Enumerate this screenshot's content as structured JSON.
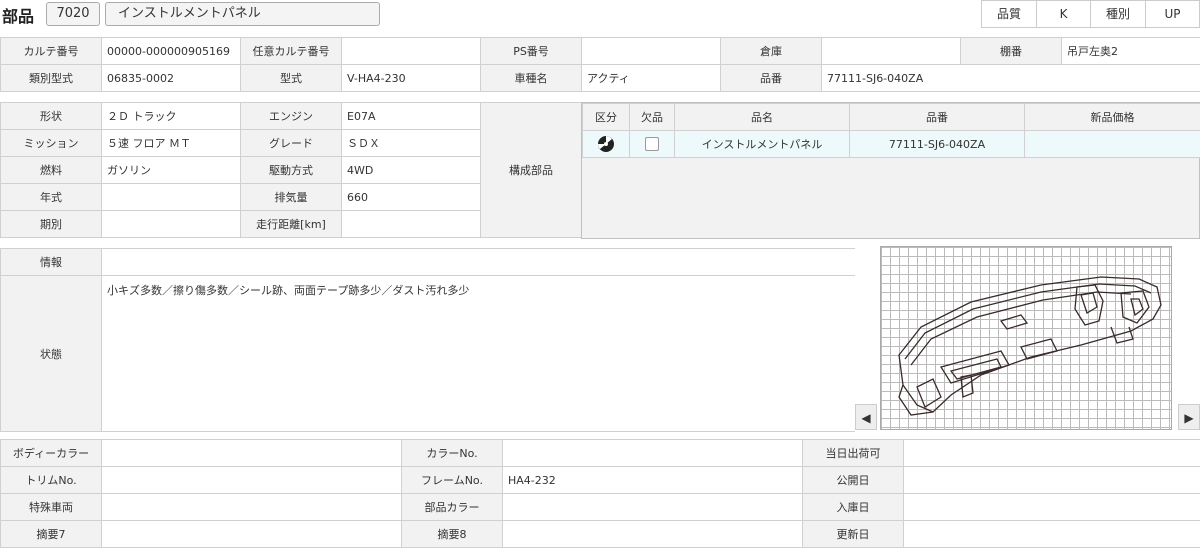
{
  "header": {
    "title": "部品",
    "code": "7020",
    "part_name": "インストルメントパネル",
    "quality_label": "品質",
    "quality_value": "K",
    "type_label": "種別",
    "type_value": "UP"
  },
  "info1": {
    "karte_label": "カルテ番号",
    "karte_value": "00000-000000905169",
    "nini_label": "任意カルテ番号",
    "nini_value": "",
    "ps_label": "PS番号",
    "ps_value": "",
    "souko_label": "倉庫",
    "souko_value": "",
    "tana_label": "棚番",
    "tana_value": "吊戸左奥2",
    "ruibetsu_label": "類別型式",
    "ruibetsu_value": "06835-0002",
    "katashiki_label": "型式",
    "katashiki_value": "V-HA4-230",
    "shamei_label": "車種名",
    "shamei_value": "アクティ",
    "hinban_label": "品番",
    "hinban_value": "77111-SJ6-040ZA"
  },
  "info2": {
    "keijo_label": "形状",
    "keijo_value": "２Ｄ トラック",
    "engine_label": "エンジン",
    "engine_value": "E07A",
    "mission_label": "ミッション",
    "mission_value": "５速 フロア ＭＴ",
    "grade_label": "グレード",
    "grade_value": "ＳＤＸ",
    "fuel_label": "燃料",
    "fuel_value": "ガソリン",
    "drive_label": "駆動方式",
    "drive_value": "4WD",
    "year_label": "年式",
    "year_value": "",
    "displacement_label": "排気量",
    "displacement_value": "660",
    "period_label": "期別",
    "period_value": "",
    "mileage_label": "走行距離[km]",
    "mileage_value": "",
    "components_label": "構成部品"
  },
  "parts_table": {
    "headers": [
      "区分",
      "欠品",
      "品名",
      "品番",
      "新品価格"
    ],
    "rows": [
      {
        "category_icon": "disc-icon",
        "missing": false,
        "name": "インストルメントパネル",
        "number": "77111-SJ6-040ZA",
        "price": ""
      }
    ]
  },
  "condition": {
    "info_label": "情報",
    "info_value": "",
    "state_label": "状態",
    "state_value": "小キズ多数／擦り傷多数／シール跡、両面テープ跡多少／ダスト汚れ多少"
  },
  "image": {
    "prev_icon": "chevron-left-icon",
    "next_icon": "chevron-right-icon"
  },
  "bottom": {
    "body_color_label": "ボディーカラー",
    "body_color_value": "",
    "color_no_label": "カラーNo.",
    "color_no_value": "",
    "ship_label": "当日出荷可",
    "ship_value": "",
    "trim_label": "トリムNo.",
    "trim_value": "",
    "frame_label": "フレームNo.",
    "frame_value": "HA4-232",
    "publish_label": "公開日",
    "publish_value": "",
    "special_label": "特殊車両",
    "special_value": "",
    "part_color_label": "部品カラー",
    "part_color_value": "",
    "stock_label": "入庫日",
    "stock_value": "",
    "memo7_label": "摘要7",
    "memo7_value": "",
    "memo8_label": "摘要8",
    "memo8_value": "",
    "update_label": "更新日",
    "update_value": ""
  }
}
